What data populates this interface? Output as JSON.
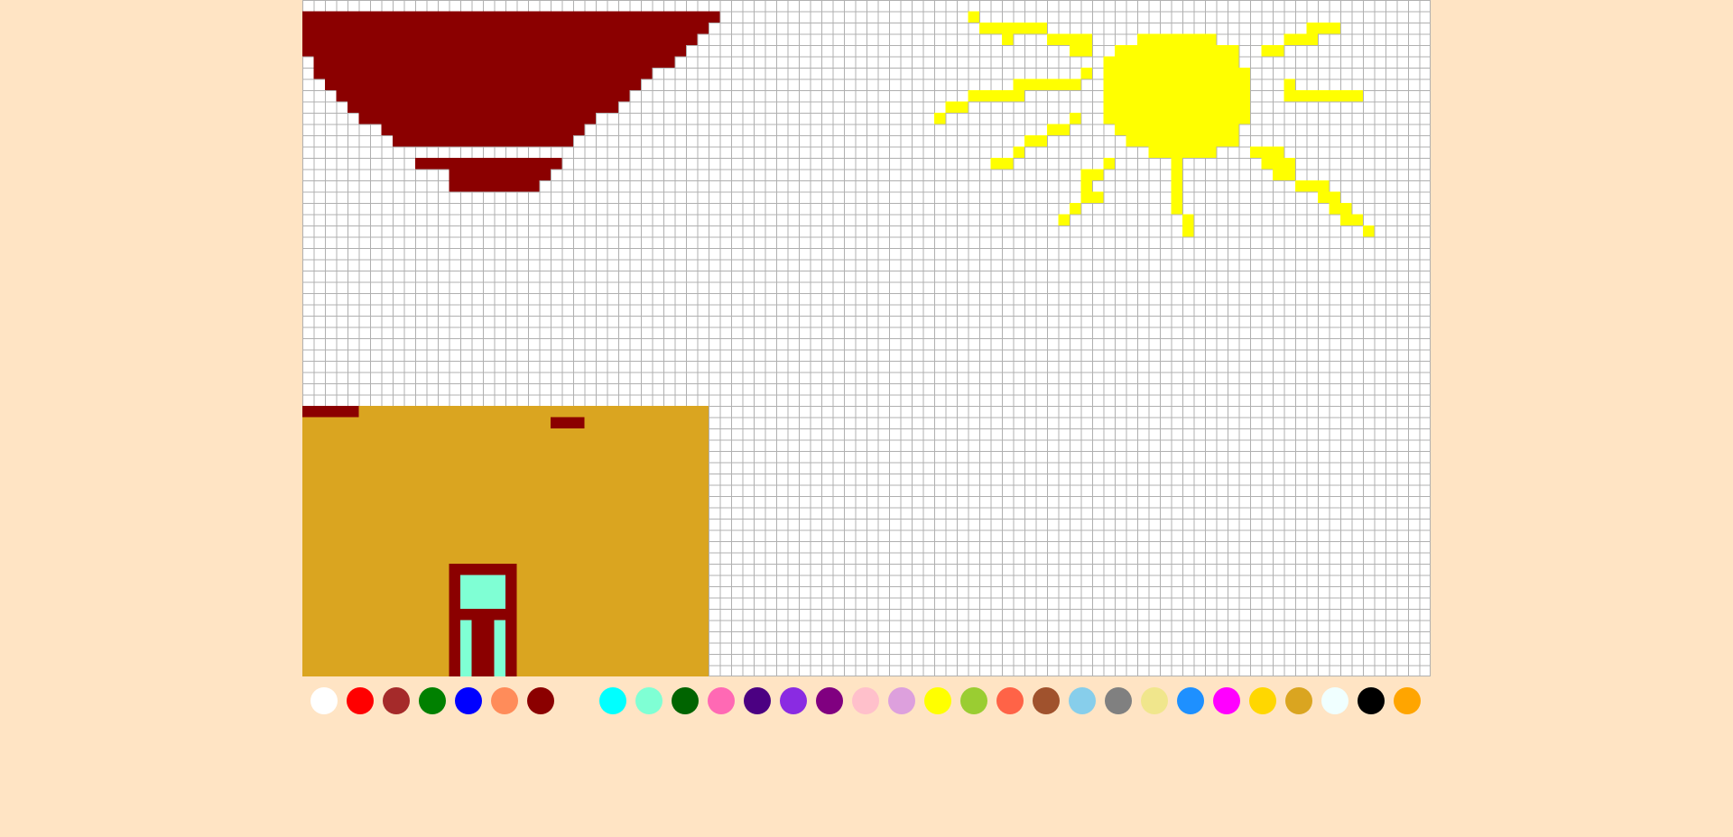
{
  "canvas": {
    "grid_cells": [
      100,
      60
    ],
    "background_color": "#ffffff",
    "grid_line_color": "#b0b0b0"
  },
  "drawing": {
    "house_wall_color": "#DAA520",
    "roof_color": "#8B0000",
    "door_frame_color": "#8B0000",
    "door_glass_color": "#7FFFD4",
    "sun_color": "#FFFF00"
  },
  "palette": {
    "colors": [
      "#FFFFFF",
      "#FF0000",
      "#A52A2A",
      "#008000",
      "#0000FF",
      "#FF8C5A",
      "#8B0000",
      "#00FFFF",
      "#7FFFD4",
      "#006400",
      "#FF69B4",
      "#4B0082",
      "#8A2BE2",
      "#800080",
      "#FFC0CB",
      "#DDA0DD",
      "#FFFF00",
      "#9ACD32",
      "#FF6347",
      "#A0522D",
      "#87CEEB",
      "#808080",
      "#F0E68C",
      "#1E90FF",
      "#FF00FF",
      "#FFD700",
      "#DAA520",
      "#F0FFFF",
      "#000000",
      "#FFA500"
    ]
  }
}
